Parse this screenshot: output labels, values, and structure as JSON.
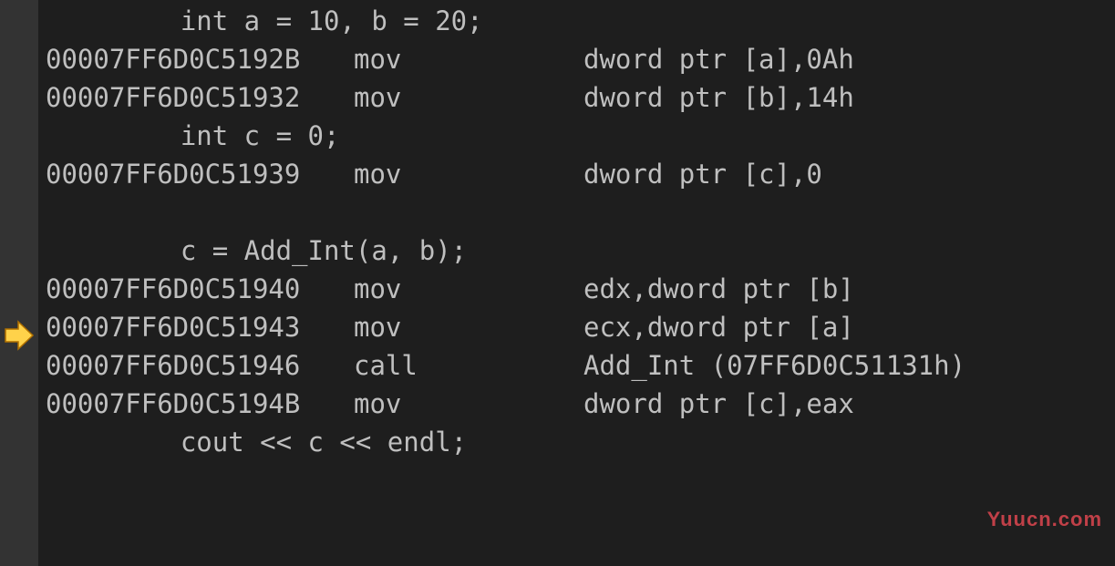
{
  "lines": [
    {
      "type": "src",
      "text": "    int a = 10, b = 20;"
    },
    {
      "type": "asm",
      "addr": "00007FF6D0C5192B",
      "op": "mov",
      "args": "dword ptr [a],0Ah"
    },
    {
      "type": "asm",
      "addr": "00007FF6D0C51932",
      "op": "mov",
      "args": "dword ptr [b],14h"
    },
    {
      "type": "src",
      "text": "    int c = 0;"
    },
    {
      "type": "asm",
      "addr": "00007FF6D0C51939",
      "op": "mov",
      "args": "dword ptr [c],0"
    },
    {
      "type": "blank"
    },
    {
      "type": "src",
      "text": "    c = Add_Int(a, b);"
    },
    {
      "type": "asm",
      "addr": "00007FF6D0C51940",
      "op": "mov",
      "args": "edx,dword ptr [b]"
    },
    {
      "type": "asm",
      "addr": "00007FF6D0C51943",
      "op": "mov",
      "args": "ecx,dword ptr [a]"
    },
    {
      "type": "asm",
      "addr": "00007FF6D0C51946",
      "op": "call",
      "args": "Add_Int (07FF6D0C51131h)"
    },
    {
      "type": "asm",
      "addr": "00007FF6D0C5194B",
      "op": "mov",
      "args": "dword ptr [c],eax"
    },
    {
      "type": "src",
      "text": "    cout << c << endl;"
    }
  ],
  "watermark": "Yuucn.com"
}
